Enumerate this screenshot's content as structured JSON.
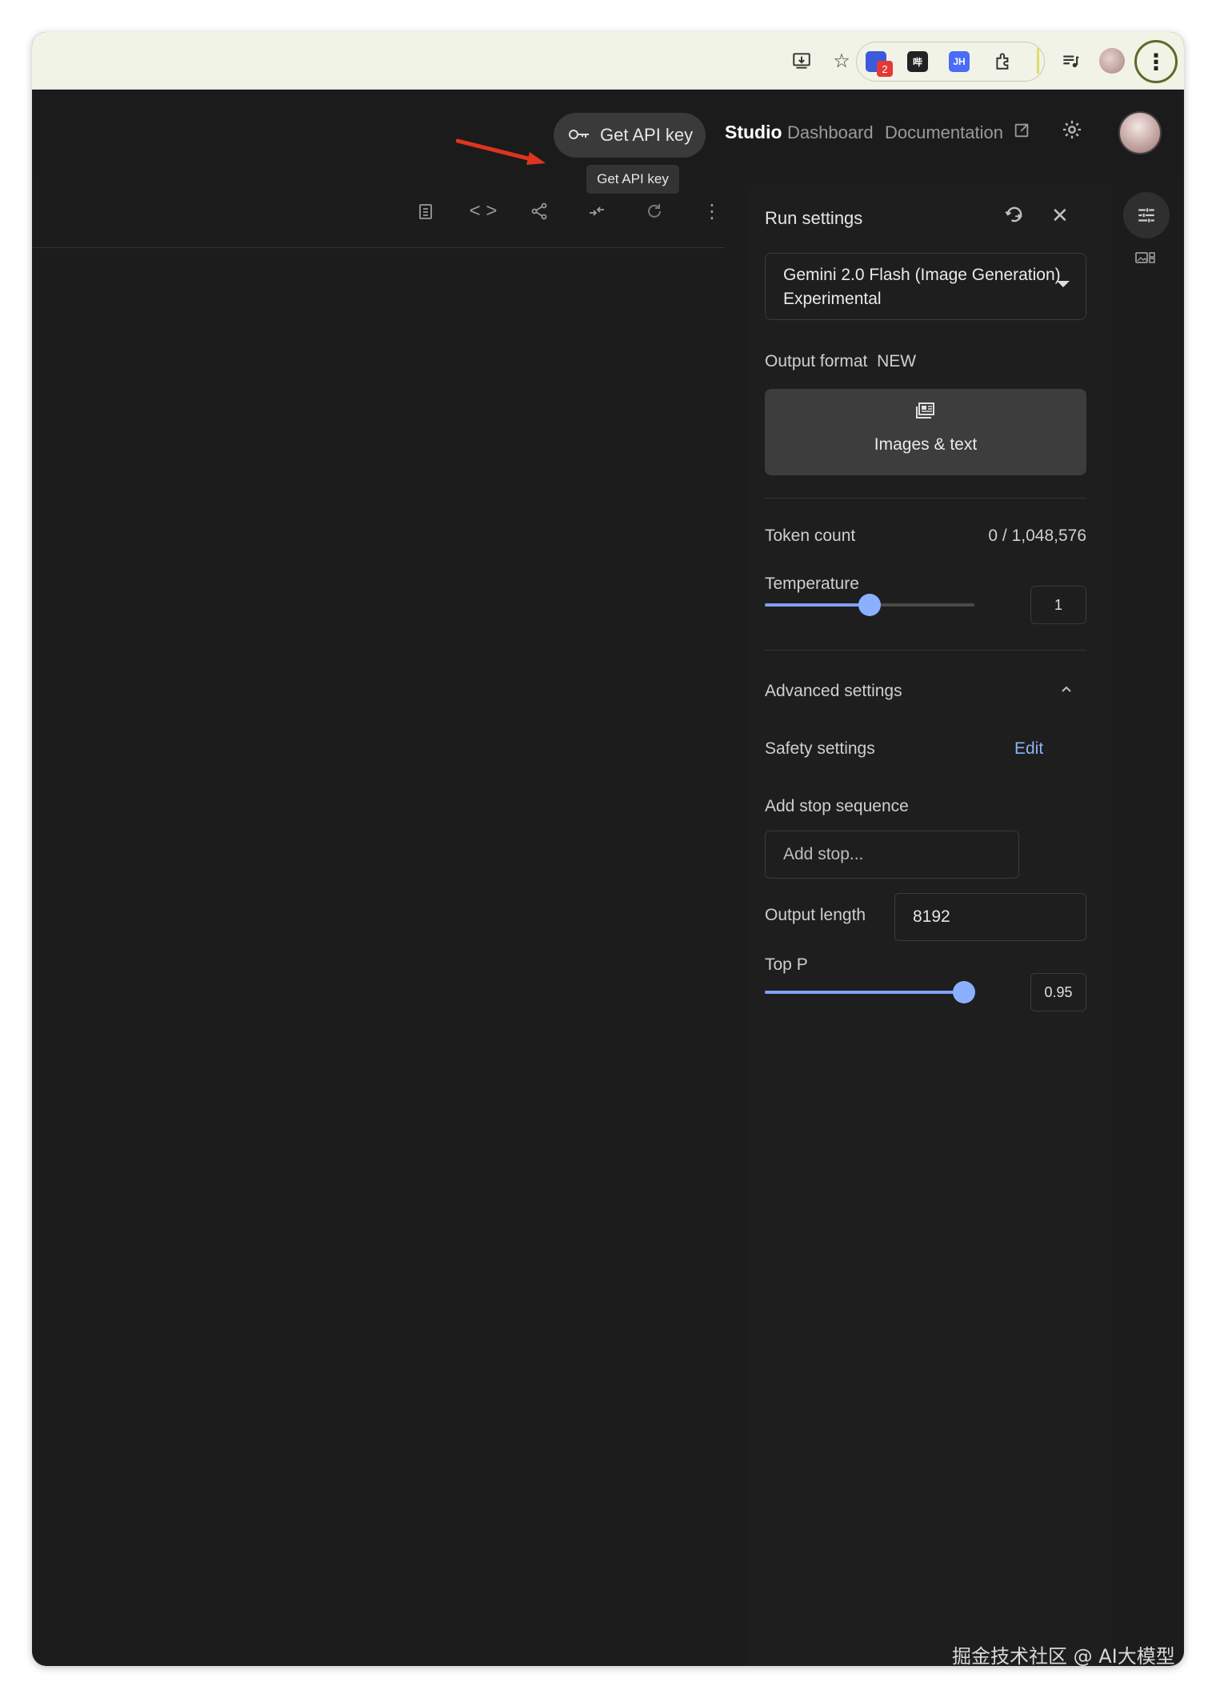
{
  "header": {
    "api_button_label": "Get API key",
    "api_tooltip": "Get API key",
    "nav_studio": "Studio",
    "nav_dashboard": "Dashboard",
    "nav_documentation": "Documentation"
  },
  "browser": {
    "extension_badge": "2",
    "ext_label_1": "哔",
    "ext_label_2": "JH"
  },
  "run_settings": {
    "title": "Run settings",
    "model": "Gemini 2.0 Flash (Image Generation) Experimental",
    "output_format_label": "Output format",
    "output_format_badge": "NEW",
    "output_format_value": "Images & text",
    "token_count_label": "Token count",
    "token_count_value": "0 / 1,048,576",
    "temperature_label": "Temperature",
    "temperature_value": "1",
    "temperature_fraction": 0.5,
    "advanced_label": "Advanced settings",
    "safety_label": "Safety settings",
    "safety_edit": "Edit",
    "stop_seq_label": "Add stop sequence",
    "stop_seq_placeholder": "Add stop...",
    "output_length_label": "Output length",
    "output_length_value": "8192",
    "top_p_label": "Top P",
    "top_p_value": "0.95",
    "top_p_fraction": 0.95
  },
  "watermark": "掘金技术社区 @ AI大模型",
  "colors": {
    "accent": "#8ab4f8",
    "arrow": "#e0341e",
    "slider": "#7ea2f5"
  },
  "icons": [
    "download-icon",
    "star-icon",
    "extensions-icon",
    "media-icon",
    "kebab-icon",
    "key-icon",
    "gear-icon",
    "external-link-icon",
    "clipboard-icon",
    "code-icon",
    "share-icon",
    "compare-icon",
    "refresh-icon",
    "reset-icon",
    "close-icon",
    "images-icon",
    "chevron-up-icon",
    "tune-icon"
  ]
}
